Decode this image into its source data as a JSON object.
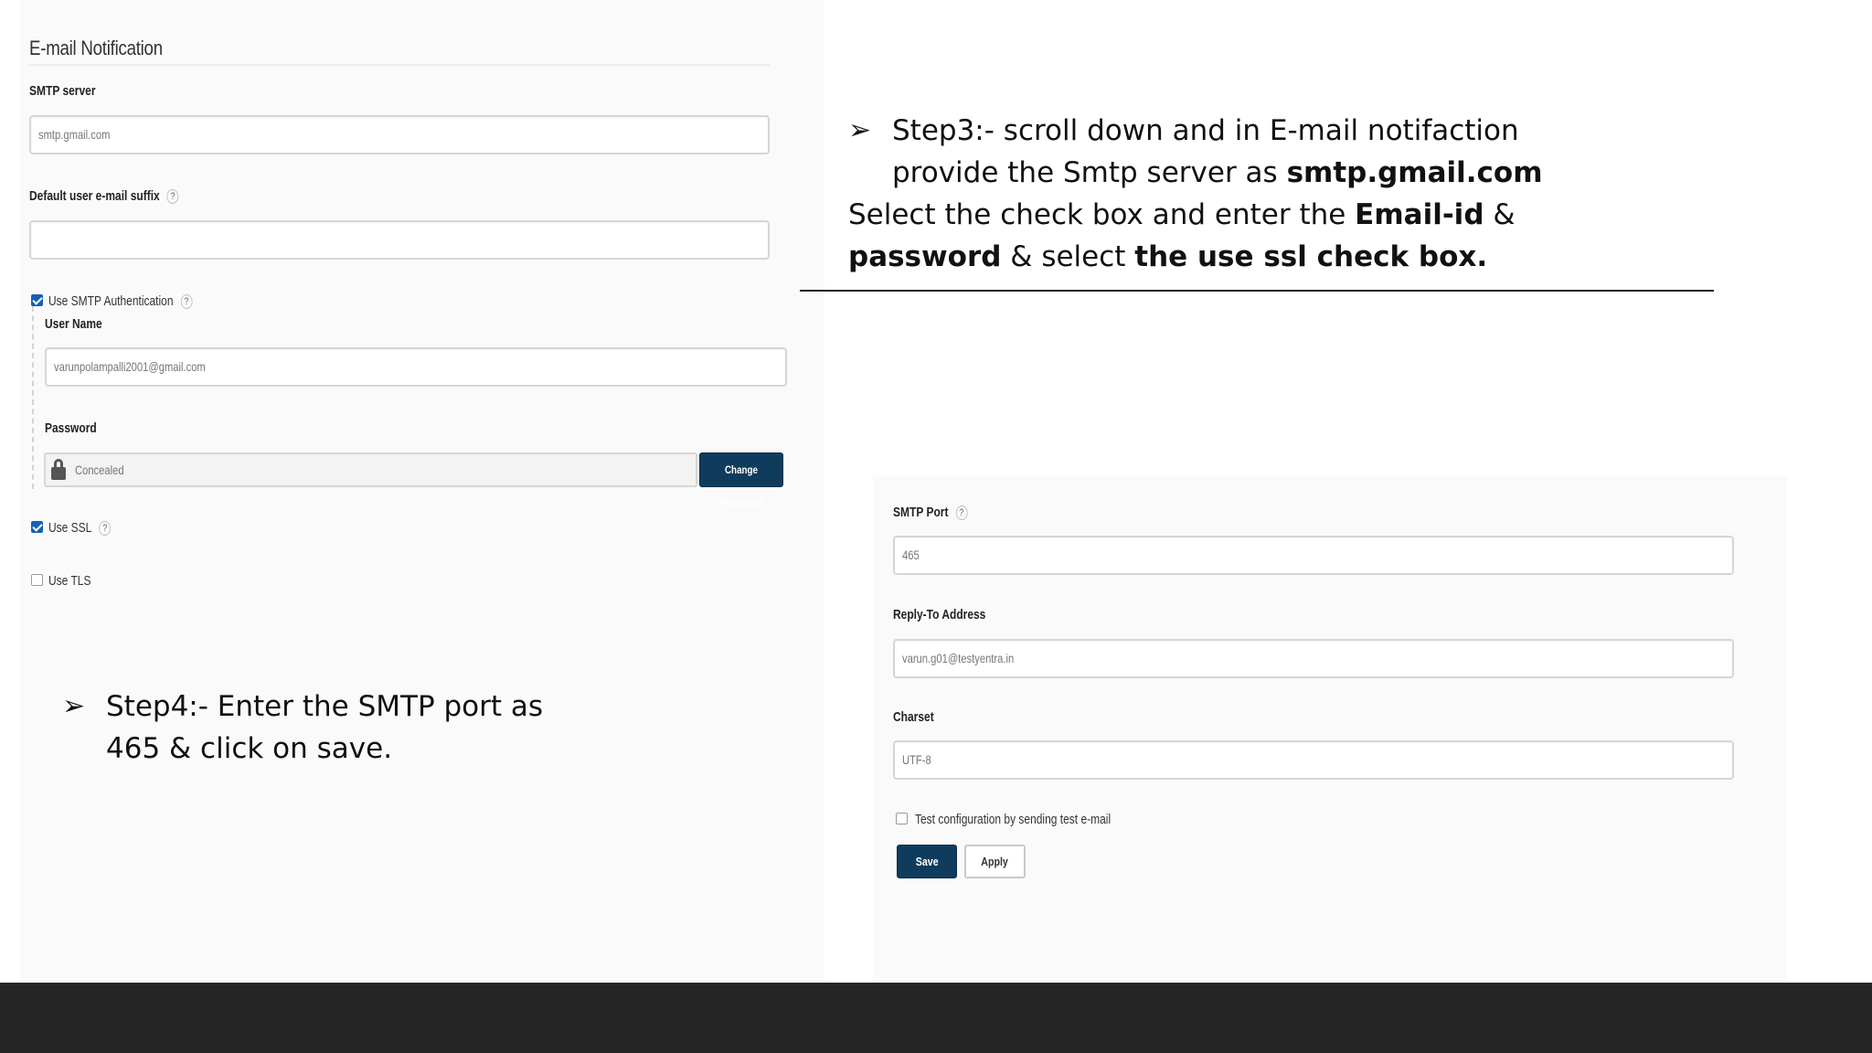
{
  "email_notification": {
    "title": "E-mail Notification",
    "smtp_server_label": "SMTP server",
    "smtp_server_value": "smtp.gmail.com",
    "default_suffix_label": "Default user e-mail suffix",
    "default_suffix_value": "",
    "use_smtp_auth_label": "Use SMTP Authentication",
    "use_smtp_auth_checked": true,
    "user_name_label": "User Name",
    "user_name_value": "varunpolampalli2001@gmail.com",
    "password_label": "Password",
    "password_value": "Concealed",
    "change_password_label": "Change Password",
    "use_ssl_label": "Use SSL",
    "use_ssl_checked": true,
    "use_tls_label": "Use TLS",
    "use_tls_checked": false,
    "help_glyph": "?"
  },
  "smtp_settings": {
    "smtp_port_label": "SMTP Port",
    "smtp_port_value": "465",
    "reply_to_label": "Reply-To Address",
    "reply_to_value": "varun.g01@testyentra.in",
    "charset_label": "Charset",
    "charset_value": "UTF-8",
    "test_config_label": "Test configuration by sending test e-mail",
    "test_config_checked": false,
    "save_label": "Save",
    "apply_label": "Apply"
  },
  "notes": {
    "arrow_glyph": "➢",
    "step3_line1": "Step3:- scroll down and in E-mail notifaction",
    "step3_line2_prefix": "provide the Smtp server as ",
    "step3_line2_bold": "smtp.gmail.com",
    "step3_line3_prefix": "Select the check box and enter the ",
    "step3_line3_bold": "Email-id",
    "step3_line3_suffix": " &",
    "step3_line4_bold1": "password",
    "step3_line4_mid": " & select ",
    "step3_line4_bold2": "the use ssl check box.",
    "step4_line1": "Step4:- Enter the SMTP port as",
    "step4_line2": "465 & click on save."
  },
  "colors": {
    "primary_button": "#0f3c5c",
    "checkbox_checked": "#1a5fb4",
    "footer": "#262626"
  }
}
